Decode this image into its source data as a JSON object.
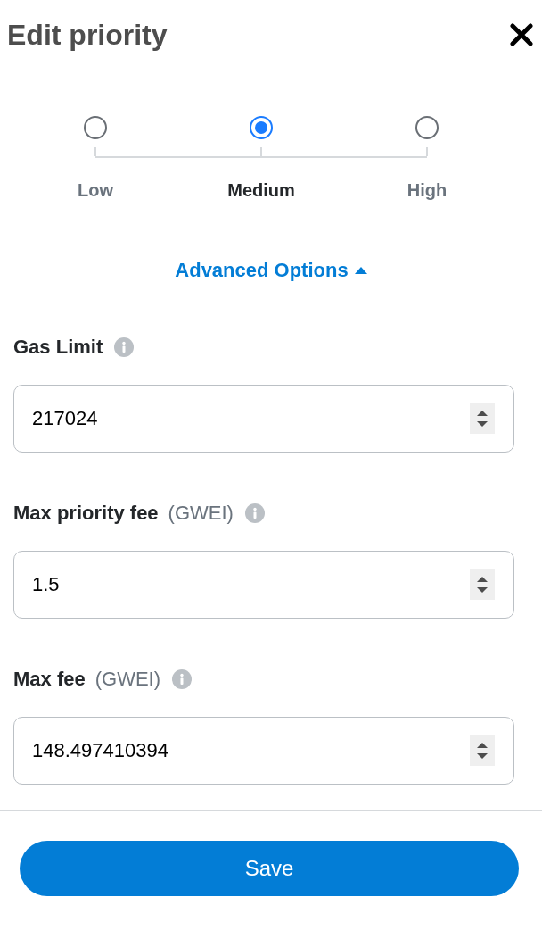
{
  "header": {
    "title": "Edit priority"
  },
  "priority_options": [
    {
      "label": "Low",
      "selected": false
    },
    {
      "label": "Medium",
      "selected": true
    },
    {
      "label": "High",
      "selected": false
    }
  ],
  "advanced_toggle": {
    "label": "Advanced Options",
    "expanded": true
  },
  "fields": [
    {
      "label": "Gas Limit",
      "value": "217024"
    },
    {
      "label": "Max priority fee",
      "unit": "(GWEI)",
      "value": "1.5"
    },
    {
      "label": "Max fee",
      "unit": "(GWEI)",
      "value": "148.497410394"
    }
  ],
  "save_button": {
    "label": "Save"
  }
}
